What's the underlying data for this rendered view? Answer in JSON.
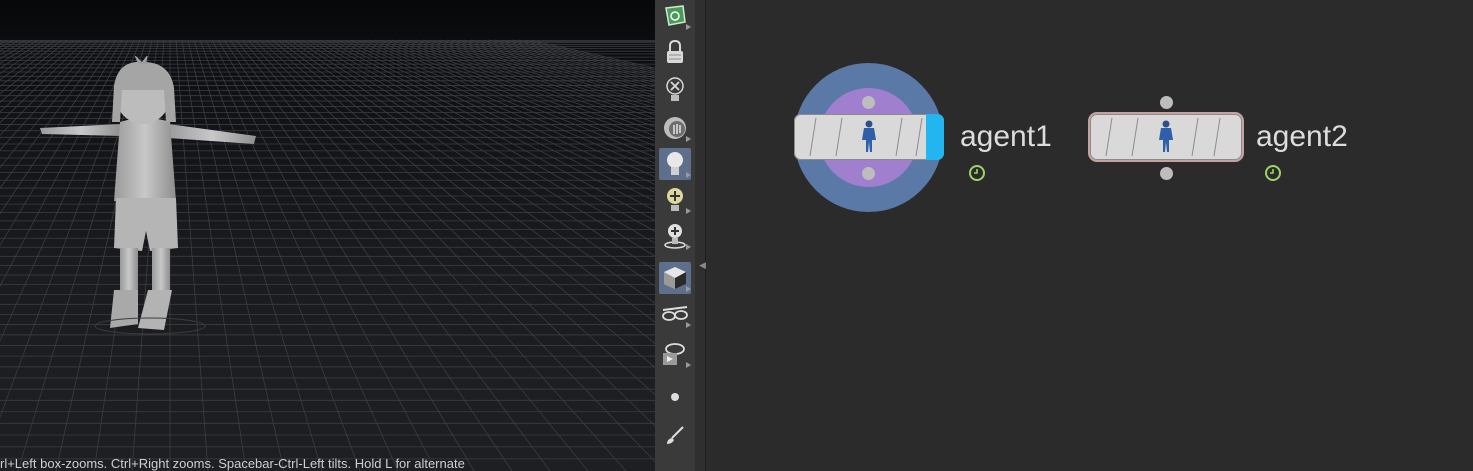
{
  "viewport": {
    "status_hint": "rl+Left box-zooms. Ctrl+Right zooms. Spacebar-Ctrl-Left tilts. Hold L for alternate"
  },
  "toolbar": {
    "tools": [
      {
        "name": "display-options-icon",
        "active": false
      },
      {
        "name": "lock-icon",
        "active": false
      },
      {
        "name": "hide-lights-icon",
        "active": false
      },
      {
        "name": "background-image-icon",
        "active": false
      },
      {
        "name": "headlight-icon",
        "active": true
      },
      {
        "name": "add-light-icon",
        "active": false
      },
      {
        "name": "light-bulb-ground-icon",
        "active": false
      },
      {
        "name": "shading-cube-icon",
        "active": true
      },
      {
        "name": "glasses-icon",
        "active": false
      },
      {
        "name": "render-glasses-icon",
        "active": false
      },
      {
        "name": "dot-icon",
        "active": false
      },
      {
        "name": "brush-icon",
        "active": false
      }
    ]
  },
  "network": {
    "nodes": [
      {
        "id": "agent1",
        "label": "agent1",
        "selected_display": true
      },
      {
        "id": "agent2",
        "label": "agent2",
        "selected_display": false
      }
    ]
  },
  "colors": {
    "display_flag": "#22b5f0",
    "ring_outer": "#5a79a6",
    "ring_inner": "#9f7fce",
    "clock_icon": "#9bd46a"
  }
}
